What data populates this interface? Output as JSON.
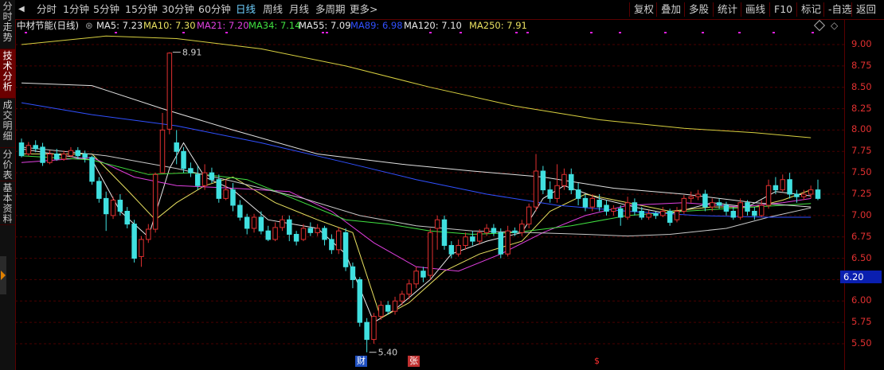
{
  "sidebar": {
    "tabs": [
      {
        "label": "分时走势",
        "active": false
      },
      {
        "label": "技术分析",
        "active": true
      },
      {
        "label": "成交明细",
        "active": false
      },
      {
        "label": "分价表",
        "active": false
      },
      {
        "label": "基本资料",
        "active": false
      }
    ]
  },
  "toolbar": {
    "back_arrow": "◀",
    "periods": [
      "分时",
      "1分钟",
      "5分钟",
      "15分钟",
      "30分钟",
      "60分钟",
      "日线",
      "周线",
      "月线",
      "多周期",
      "更多>"
    ],
    "active_period": "日线",
    "right_buttons": [
      "复权",
      "叠加",
      "多股",
      "统计",
      "画线",
      "F10",
      "标记",
      "-自选",
      "返回"
    ]
  },
  "info": {
    "stock": "中材节能(日线)",
    "ma_values": [
      {
        "label": "MA5: 7.23",
        "color": "#e8e8e8"
      },
      {
        "label": "MA10: 7.30",
        "color": "#e8e060"
      },
      {
        "label": "MA21: 7.20",
        "color": "#e040e0"
      },
      {
        "label": "MA34: 7.14",
        "color": "#40e040"
      },
      {
        "label": "MA55: 7.09",
        "color": "#e8e8e8"
      },
      {
        "label": "MA89: 6.98",
        "color": "#3050ff"
      },
      {
        "label": "MA120: 7.10",
        "color": "#e8e8e8"
      },
      {
        "label": "MA250: 7.91",
        "color": "#e8e060"
      }
    ]
  },
  "yaxis": {
    "ticks": [
      "9.00",
      "8.75",
      "8.50",
      "8.25",
      "8.00",
      "7.75",
      "7.50",
      "7.25",
      "7.00",
      "6.75",
      "6.50",
      "6.25",
      "6.00",
      "5.75",
      "5.50"
    ],
    "current_label": "6.20"
  },
  "events": [
    {
      "label": "财",
      "bg": "#2050c0",
      "color": "#ffffff"
    },
    {
      "label": "张",
      "bg": "#c03030",
      "color": "#ffffff"
    },
    {
      "label": "$",
      "bg": "#000000",
      "color": "#ff3030"
    }
  ],
  "annotations": {
    "high": "8.91",
    "low": "5.40"
  },
  "colors": {
    "up": "#e03030",
    "down": "#40e0e0",
    "grid": "#4a0000",
    "accent": "#6fd0ff"
  },
  "chart_data": {
    "type": "candlestick",
    "ylim": [
      5.4,
      9.2
    ],
    "candles": [
      [
        7.85,
        7.7,
        7.9,
        7.68
      ],
      [
        7.72,
        7.82,
        7.86,
        7.7
      ],
      [
        7.82,
        7.78,
        7.88,
        7.74
      ],
      [
        7.8,
        7.62,
        7.85,
        7.58
      ],
      [
        7.62,
        7.72,
        7.76,
        7.6
      ],
      [
        7.72,
        7.66,
        7.78,
        7.64
      ],
      [
        7.66,
        7.72,
        7.76,
        7.64
      ],
      [
        7.7,
        7.76,
        7.8,
        7.68
      ],
      [
        7.76,
        7.7,
        7.8,
        7.66
      ],
      [
        7.72,
        7.68,
        7.76,
        7.62
      ],
      [
        7.68,
        7.4,
        7.7,
        7.36
      ],
      [
        7.4,
        7.2,
        7.45,
        7.15
      ],
      [
        7.2,
        7.02,
        7.28,
        6.82
      ],
      [
        7.0,
        7.18,
        7.22,
        6.96
      ],
      [
        7.18,
        7.05,
        7.25,
        7.0
      ],
      [
        7.05,
        6.9,
        7.1,
        6.85
      ],
      [
        6.9,
        6.5,
        6.95,
        6.45
      ],
      [
        6.52,
        6.72,
        6.76,
        6.4
      ],
      [
        6.72,
        6.84,
        6.9,
        6.68
      ],
      [
        6.84,
        7.48,
        7.5,
        6.8
      ],
      [
        7.5,
        8.0,
        8.2,
        7.95
      ],
      [
        8.01,
        8.9,
        8.91,
        7.95
      ],
      [
        7.85,
        7.75,
        8.0,
        7.6
      ],
      [
        7.75,
        7.55,
        7.8,
        7.5
      ],
      [
        7.55,
        7.5,
        7.62,
        7.45
      ],
      [
        7.48,
        7.35,
        7.58,
        7.3
      ],
      [
        7.35,
        7.5,
        7.6,
        7.3
      ],
      [
        7.5,
        7.42,
        7.56,
        7.38
      ],
      [
        7.42,
        7.2,
        7.48,
        7.15
      ],
      [
        7.2,
        7.3,
        7.42,
        7.18
      ],
      [
        7.3,
        7.12,
        7.38,
        7.05
      ],
      [
        7.12,
        6.98,
        7.18,
        6.94
      ],
      [
        6.98,
        6.85,
        7.02,
        6.78
      ],
      [
        6.85,
        6.98,
        7.02,
        6.8
      ],
      [
        6.98,
        6.82,
        7.05,
        6.78
      ],
      [
        6.82,
        6.72,
        6.88,
        6.7
      ],
      [
        6.72,
        6.86,
        6.92,
        6.7
      ],
      [
        6.86,
        6.95,
        7.0,
        6.82
      ],
      [
        6.95,
        6.78,
        7.0,
        6.7
      ],
      [
        6.78,
        6.7,
        6.82,
        6.65
      ],
      [
        6.72,
        6.85,
        6.9,
        6.7
      ],
      [
        6.85,
        6.8,
        6.92,
        6.76
      ],
      [
        6.8,
        6.85,
        6.9,
        6.76
      ],
      [
        6.85,
        6.72,
        6.88,
        6.65
      ],
      [
        6.72,
        6.6,
        6.78,
        6.55
      ],
      [
        6.6,
        6.82,
        6.86,
        6.55
      ],
      [
        6.8,
        6.4,
        6.85,
        6.35
      ],
      [
        6.4,
        6.25,
        6.45,
        6.15
      ],
      [
        6.25,
        5.75,
        6.28,
        5.7
      ],
      [
        5.75,
        5.55,
        5.8,
        5.4
      ],
      [
        5.55,
        5.82,
        5.86,
        5.5
      ],
      [
        5.82,
        5.95,
        6.0,
        5.78
      ],
      [
        5.95,
        5.88,
        6.0,
        5.84
      ],
      [
        5.88,
        6.0,
        6.05,
        5.84
      ],
      [
        6.0,
        6.08,
        6.12,
        5.95
      ],
      [
        6.08,
        6.2,
        6.25,
        6.02
      ],
      [
        6.2,
        6.35,
        6.4,
        6.15
      ],
      [
        6.35,
        6.28,
        6.4,
        6.22
      ],
      [
        6.3,
        6.8,
        6.85,
        6.25
      ],
      [
        6.85,
        6.95,
        7.0,
        6.6
      ],
      [
        6.95,
        6.65,
        7.0,
        6.6
      ],
      [
        6.65,
        6.55,
        6.7,
        6.5
      ],
      [
        6.55,
        6.65,
        6.72,
        6.52
      ],
      [
        6.65,
        6.75,
        6.8,
        6.6
      ],
      [
        6.75,
        6.7,
        6.82,
        6.65
      ],
      [
        6.7,
        6.8,
        6.84,
        6.66
      ],
      [
        6.8,
        6.85,
        6.9,
        6.76
      ],
      [
        6.85,
        6.8,
        6.9,
        6.76
      ],
      [
        6.8,
        6.55,
        6.85,
        6.5
      ],
      [
        6.55,
        6.82,
        6.88,
        6.52
      ],
      [
        6.82,
        6.8,
        6.86,
        6.76
      ],
      [
        6.8,
        6.9,
        6.95,
        6.76
      ],
      [
        6.9,
        7.1,
        7.14,
        6.85
      ],
      [
        7.1,
        7.52,
        7.72,
        7.05
      ],
      [
        7.52,
        7.3,
        7.58,
        7.25
      ],
      [
        7.3,
        7.2,
        7.4,
        7.15
      ],
      [
        7.2,
        7.35,
        7.6,
        7.15
      ],
      [
        7.35,
        7.48,
        7.55,
        7.3
      ],
      [
        7.48,
        7.3,
        7.55,
        7.25
      ],
      [
        7.3,
        7.2,
        7.38,
        7.12
      ],
      [
        7.2,
        7.1,
        7.25,
        7.05
      ],
      [
        7.1,
        7.2,
        7.25,
        7.05
      ],
      [
        7.18,
        7.1,
        7.25,
        7.05
      ],
      [
        7.12,
        7.05,
        7.18,
        7.0
      ],
      [
        7.05,
        7.08,
        7.12,
        7.0
      ],
      [
        7.08,
        6.98,
        7.12,
        6.88
      ],
      [
        6.98,
        7.15,
        7.22,
        6.95
      ],
      [
        7.15,
        7.05,
        7.2,
        7.0
      ],
      [
        7.05,
        6.98,
        7.1,
        6.95
      ],
      [
        6.98,
        7.02,
        7.06,
        6.95
      ],
      [
        7.02,
        7.0,
        7.05,
        6.96
      ],
      [
        7.0,
        7.05,
        7.1,
        6.98
      ],
      [
        7.05,
        6.92,
        7.08,
        6.88
      ],
      [
        6.95,
        7.05,
        7.1,
        6.92
      ],
      [
        7.05,
        7.2,
        7.24,
        7.02
      ],
      [
        7.2,
        7.22,
        7.28,
        7.15
      ],
      [
        7.22,
        7.25,
        7.3,
        7.18
      ],
      [
        7.25,
        7.1,
        7.3,
        7.05
      ],
      [
        7.1,
        7.15,
        7.2,
        7.05
      ],
      [
        7.15,
        7.12,
        7.2,
        7.08
      ],
      [
        7.12,
        7.05,
        7.16,
        7.0
      ],
      [
        7.05,
        6.98,
        7.1,
        6.95
      ],
      [
        6.98,
        7.15,
        7.2,
        6.95
      ],
      [
        7.15,
        7.05,
        7.18,
        7.0
      ],
      [
        7.05,
        7.0,
        7.1,
        6.95
      ],
      [
        7.0,
        7.12,
        7.18,
        6.98
      ],
      [
        7.12,
        7.35,
        7.42,
        7.08
      ],
      [
        7.35,
        7.3,
        7.45,
        7.25
      ],
      [
        7.3,
        7.42,
        7.48,
        7.28
      ],
      [
        7.42,
        7.25,
        7.5,
        7.2
      ],
      [
        7.25,
        7.22,
        7.3,
        7.15
      ],
      [
        7.22,
        7.25,
        7.3,
        7.18
      ],
      [
        7.25,
        7.3,
        7.35,
        7.2
      ],
      [
        7.3,
        7.2,
        7.42,
        7.18
      ]
    ],
    "ma_lines": {
      "MA5": {
        "color": "#e8e8e8",
        "points": [
          [
            0,
            7.78
          ],
          [
            10,
            7.65
          ],
          [
            14,
            7.05
          ],
          [
            18,
            6.75
          ],
          [
            21,
            7.55
          ],
          [
            23,
            7.85
          ],
          [
            26,
            7.45
          ],
          [
            30,
            7.3
          ],
          [
            35,
            6.95
          ],
          [
            42,
            6.85
          ],
          [
            46,
            6.55
          ],
          [
            50,
            5.75
          ],
          [
            53,
            5.9
          ],
          [
            58,
            6.25
          ],
          [
            61,
            6.55
          ],
          [
            66,
            6.7
          ],
          [
            71,
            6.8
          ],
          [
            74,
            7.2
          ],
          [
            77,
            7.35
          ],
          [
            82,
            7.2
          ],
          [
            88,
            7.08
          ],
          [
            92,
            7.02
          ],
          [
            98,
            7.15
          ],
          [
            103,
            7.1
          ],
          [
            107,
            7.28
          ],
          [
            112,
            7.23
          ]
        ]
      },
      "MA10": {
        "color": "#e8e060",
        "points": [
          [
            0,
            7.72
          ],
          [
            10,
            7.72
          ],
          [
            15,
            7.3
          ],
          [
            19,
            6.95
          ],
          [
            22,
            7.15
          ],
          [
            26,
            7.35
          ],
          [
            30,
            7.45
          ],
          [
            36,
            7.15
          ],
          [
            42,
            6.95
          ],
          [
            47,
            6.8
          ],
          [
            51,
            5.8
          ],
          [
            55,
            5.98
          ],
          [
            60,
            6.35
          ],
          [
            65,
            6.55
          ],
          [
            71,
            6.7
          ],
          [
            75,
            7.05
          ],
          [
            80,
            7.25
          ],
          [
            86,
            7.15
          ],
          [
            92,
            7.05
          ],
          [
            98,
            7.1
          ],
          [
            104,
            7.1
          ],
          [
            108,
            7.18
          ],
          [
            112,
            7.3
          ]
        ]
      },
      "MA21": {
        "color": "#e040e0",
        "points": [
          [
            0,
            7.62
          ],
          [
            10,
            7.68
          ],
          [
            16,
            7.45
          ],
          [
            22,
            7.35
          ],
          [
            30,
            7.32
          ],
          [
            38,
            7.28
          ],
          [
            44,
            7.05
          ],
          [
            50,
            6.68
          ],
          [
            56,
            6.4
          ],
          [
            62,
            6.35
          ],
          [
            68,
            6.55
          ],
          [
            74,
            6.8
          ],
          [
            80,
            7.0
          ],
          [
            86,
            7.12
          ],
          [
            94,
            7.15
          ],
          [
            102,
            7.1
          ],
          [
            108,
            7.15
          ],
          [
            112,
            7.2
          ]
        ]
      },
      "MA34": {
        "color": "#40e040",
        "points": [
          [
            0,
            7.7
          ],
          [
            10,
            7.65
          ],
          [
            18,
            7.48
          ],
          [
            24,
            7.5
          ],
          [
            32,
            7.42
          ],
          [
            40,
            7.15
          ],
          [
            46,
            6.95
          ],
          [
            52,
            6.9
          ],
          [
            58,
            6.82
          ],
          [
            64,
            6.78
          ],
          [
            70,
            6.8
          ],
          [
            78,
            6.88
          ],
          [
            86,
            7.0
          ],
          [
            94,
            7.05
          ],
          [
            104,
            7.1
          ],
          [
            112,
            7.14
          ]
        ]
      },
      "MA55": {
        "color": "#c8c8c8",
        "points": [
          [
            0,
            7.8
          ],
          [
            12,
            7.7
          ],
          [
            22,
            7.55
          ],
          [
            30,
            7.4
          ],
          [
            40,
            7.2
          ],
          [
            48,
            7.0
          ],
          [
            56,
            6.88
          ],
          [
            64,
            6.82
          ],
          [
            72,
            6.8
          ],
          [
            80,
            6.78
          ],
          [
            86,
            6.76
          ],
          [
            92,
            6.78
          ],
          [
            100,
            6.85
          ],
          [
            106,
            6.98
          ],
          [
            112,
            7.09
          ]
        ]
      },
      "MA89": {
        "color": "#3050ff",
        "points": [
          [
            0,
            8.32
          ],
          [
            10,
            8.18
          ],
          [
            22,
            8.05
          ],
          [
            34,
            7.85
          ],
          [
            46,
            7.62
          ],
          [
            56,
            7.42
          ],
          [
            66,
            7.25
          ],
          [
            76,
            7.12
          ],
          [
            86,
            7.05
          ],
          [
            96,
            7.0
          ],
          [
            106,
            6.98
          ],
          [
            112,
            6.98
          ]
        ]
      },
      "MA120": {
        "color": "#e0e0e0",
        "points": [
          [
            0,
            8.55
          ],
          [
            10,
            8.52
          ],
          [
            20,
            8.25
          ],
          [
            30,
            8.0
          ],
          [
            42,
            7.72
          ],
          [
            54,
            7.6
          ],
          [
            64,
            7.52
          ],
          [
            74,
            7.45
          ],
          [
            84,
            7.32
          ],
          [
            94,
            7.25
          ],
          [
            104,
            7.15
          ],
          [
            112,
            7.1
          ]
        ]
      },
      "MA250": {
        "color": "#d8d040",
        "points": [
          [
            0,
            9.0
          ],
          [
            12,
            9.1
          ],
          [
            22,
            9.07
          ],
          [
            34,
            8.95
          ],
          [
            46,
            8.75
          ],
          [
            58,
            8.5
          ],
          [
            70,
            8.28
          ],
          [
            82,
            8.12
          ],
          [
            94,
            8.02
          ],
          [
            104,
            7.97
          ],
          [
            112,
            7.91
          ]
        ]
      }
    }
  }
}
